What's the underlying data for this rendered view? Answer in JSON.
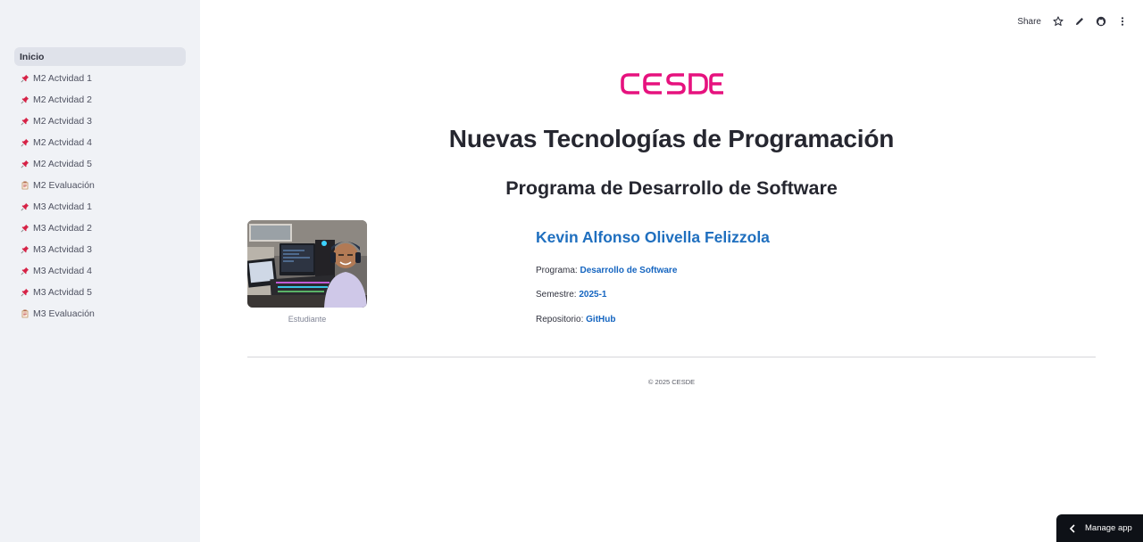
{
  "sidebar": {
    "items": [
      {
        "label": "Inicio",
        "icon": "",
        "active": true
      },
      {
        "label": "M2 Actvidad 1",
        "icon": "pushpin-icon"
      },
      {
        "label": "M2 Actvidad 2",
        "icon": "pushpin-icon"
      },
      {
        "label": "M2 Actvidad 3",
        "icon": "pushpin-icon"
      },
      {
        "label": "M2 Actvidad 4",
        "icon": "pushpin-icon"
      },
      {
        "label": "M2 Actvidad 5",
        "icon": "pushpin-icon"
      },
      {
        "label": "M2 Evaluación",
        "icon": "clipboard-icon"
      },
      {
        "label": "M3 Actvidad 1",
        "icon": "pushpin-icon"
      },
      {
        "label": "M3 Actvidad 2",
        "icon": "pushpin-icon"
      },
      {
        "label": "M3 Actvidad 3",
        "icon": "pushpin-icon"
      },
      {
        "label": "M3 Actvidad 4",
        "icon": "pushpin-icon"
      },
      {
        "label": "M3 Actvidad 5",
        "icon": "pushpin-icon"
      },
      {
        "label": "M3 Evaluación",
        "icon": "clipboard-icon"
      }
    ]
  },
  "toolbar": {
    "share_label": "Share",
    "icons": [
      "star-icon",
      "pencil-icon",
      "github-icon",
      "kebab-menu-icon"
    ]
  },
  "main": {
    "logo_text": "CESDE",
    "title": "Nuevas Tecnologías de Programación",
    "subtitle": "Programa de Desarrollo de Software",
    "photo_caption": "Estudiante",
    "student_name": "Kevin Alfonso Olivella Felizzola",
    "programa_label": "Programa: ",
    "programa_value": "Desarrollo de Software",
    "semestre_label": "Semestre: ",
    "semestre_value": "2025-1",
    "repo_label": "Repositorio: ",
    "repo_value": "GitHub",
    "footer": "© 2025 CESDE"
  },
  "manage_app": {
    "label": "Manage app"
  },
  "colors": {
    "sidebar_bg": "#f0f2f6",
    "active_item_bg": "#dfe2ea",
    "brand_pink": "#e6127e",
    "link_blue": "#1565c0",
    "manage_bg": "#0e1117"
  }
}
